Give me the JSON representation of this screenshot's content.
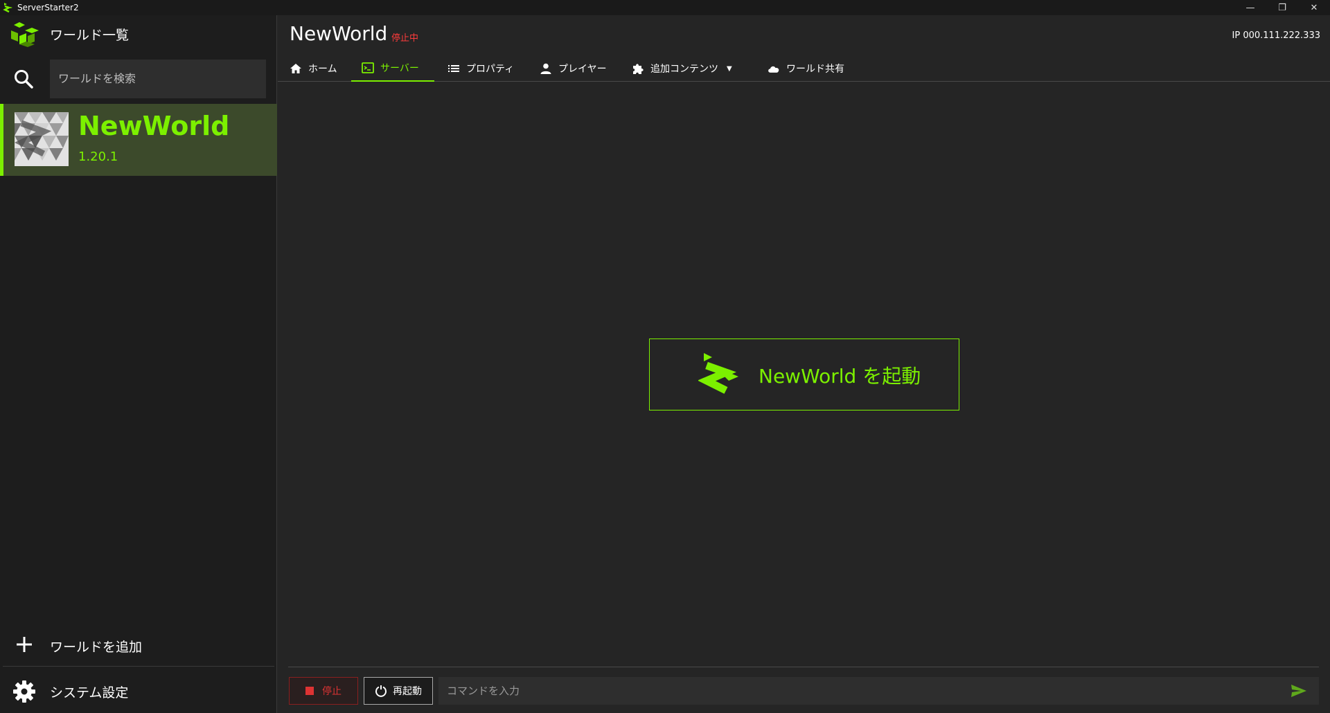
{
  "window": {
    "title": "ServerStarter2",
    "controls": [
      "—",
      "❐",
      "✕"
    ]
  },
  "sidebar": {
    "header_title": "ワールド一覧",
    "search_placeholder": "ワールドを検索",
    "worlds": [
      {
        "name": "NewWorld",
        "version": "1.20.1",
        "selected": true
      }
    ],
    "add_label": "ワールドを追加",
    "settings_label": "システム設定"
  },
  "main": {
    "world_title": "NewWorld",
    "status": "停止中",
    "ip": "IP 000.111.222.333",
    "tabs": [
      {
        "label": "ホーム",
        "icon": "home-icon"
      },
      {
        "label": "サーバー",
        "icon": "terminal-icon",
        "active": true
      },
      {
        "label": "プロパティ",
        "icon": "list-icon"
      },
      {
        "label": "プレイヤー",
        "icon": "person-icon"
      },
      {
        "label": "追加コンテンツ",
        "icon": "puzzle-icon",
        "dropdown": true
      },
      {
        "label": "ワールド共有",
        "icon": "cloud-icon"
      }
    ],
    "launch_label": "NewWorld を起動",
    "console": {
      "stop_label": "停止",
      "restart_label": "再起動",
      "command_placeholder": "コマンドを入力"
    }
  },
  "colors": {
    "accent": "#7cf000",
    "status_stopped": "#ff3b3b",
    "background": "#252525",
    "sidebar": "#1d1d1d",
    "selected_item": "#3c4a2b"
  }
}
